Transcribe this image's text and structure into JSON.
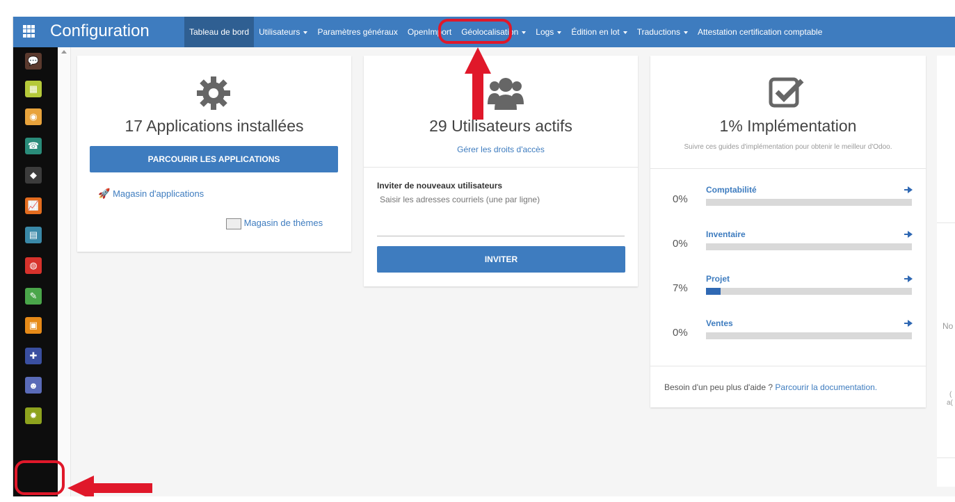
{
  "brand": "Configuration",
  "menu": {
    "tableau": "Tableau de bord",
    "utilisateurs": "Utilisateurs",
    "parametres": "Paramètres généraux",
    "openimport": "OpenImport",
    "geolocalisation": "Géolocalisation",
    "logs": "Logs",
    "edition": "Édition en lot",
    "traductions": "Traductions",
    "attestation": "Attestation certification comptable"
  },
  "apps_card": {
    "title": "17 Applications installées",
    "button": "PARCOURIR LES APPLICATIONS",
    "store_link": "Magasin d'applications",
    "themes_link": "Magasin de thèmes"
  },
  "users_card": {
    "title": "29 Utilisateurs actifs",
    "manage_link": "Gérer les droits d'accès",
    "invite_label": "Inviter de nouveaux utilisateurs",
    "invite_placeholder": "Saisir les adresses courriels (une par ligne)",
    "invite_button": "INVITER"
  },
  "impl_card": {
    "title": "1% Implémentation",
    "subtitle": "Suivre ces guides d'implémentation pour obtenir le meilleur d'Odoo.",
    "items": [
      {
        "pct": "0%",
        "label": "Comptabilité",
        "progress": 0
      },
      {
        "pct": "0%",
        "label": "Inventaire",
        "progress": 0
      },
      {
        "pct": "7%",
        "label": "Projet",
        "progress": 0.07
      },
      {
        "pct": "0%",
        "label": "Ventes",
        "progress": 0
      }
    ],
    "help_text": "Besoin d'un peu plus d'aide ?",
    "help_link": "Parcourir la documentation."
  },
  "partial_right": {
    "text1": "No",
    "text2": "(",
    "text3": "a("
  },
  "sidebar_icons": [
    {
      "name": "discuss-icon",
      "color": "#5b3a2e",
      "glyph": "💬"
    },
    {
      "name": "calendar-icon",
      "color": "#b5c93a",
      "glyph": "▦"
    },
    {
      "name": "location-icon",
      "color": "#e8a33c",
      "glyph": "◉"
    },
    {
      "name": "contacts-icon",
      "color": "#2a8c7a",
      "glyph": "☎"
    },
    {
      "name": "crm-icon",
      "color": "#3c3c3c",
      "glyph": "◆"
    },
    {
      "name": "sales-icon",
      "color": "#e36c1f",
      "glyph": "📈"
    },
    {
      "name": "invoicing-icon",
      "color": "#3a89a8",
      "glyph": "▤"
    },
    {
      "name": "inventory-icon",
      "color": "#d7322c",
      "glyph": "◍"
    },
    {
      "name": "tools-icon",
      "color": "#4aa64a",
      "glyph": "✎"
    },
    {
      "name": "notes-icon",
      "color": "#e68a18",
      "glyph": "▣"
    },
    {
      "name": "apps-puzzle-icon",
      "color": "#3a4fa0",
      "glyph": "✚"
    },
    {
      "name": "employees-icon",
      "color": "#5a6bb8",
      "glyph": "☻"
    },
    {
      "name": "settings-icon",
      "color": "#8ea31e",
      "glyph": "✹"
    }
  ],
  "colors": {
    "topbar": "#3e7cbf",
    "accent": "#2f68b3",
    "annotation": "#e0182a"
  }
}
